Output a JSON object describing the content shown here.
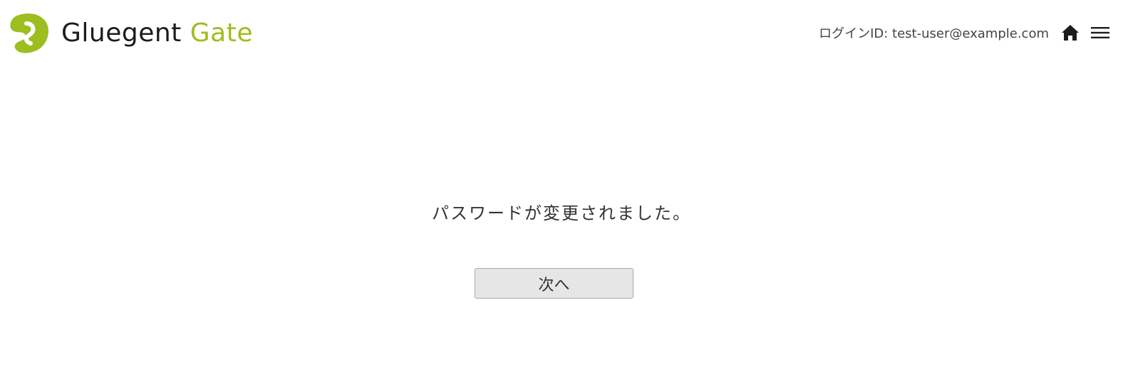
{
  "header": {
    "logo": {
      "word1": "Gluegent",
      "word2": "Gate",
      "icon": "gluegent-logo-icon"
    },
    "login_id": "ログインID: test-user@example.com",
    "home_icon": "home-icon",
    "menu_icon": "hamburger-menu-icon"
  },
  "main": {
    "message": "パスワードが変更されました。",
    "next_button_label": "次へ"
  },
  "colors": {
    "brand_green": "#9ebd1f",
    "text_dark": "#333333",
    "button_bg": "#e6e6e6",
    "button_border": "#a9a9a9"
  }
}
